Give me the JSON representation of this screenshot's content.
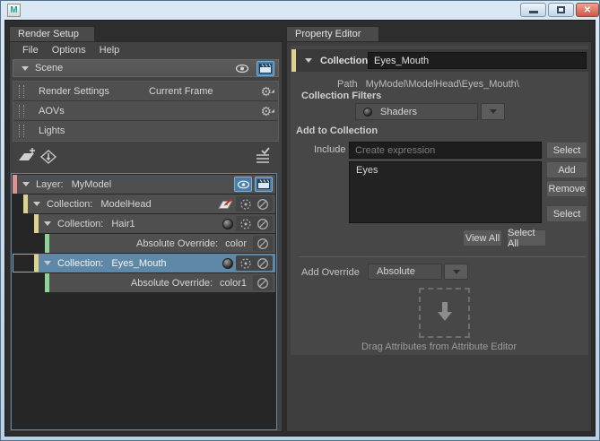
{
  "window": {
    "app_icon": "M",
    "controls": {
      "minimize": "minimize",
      "maximize": "maximize",
      "close": "close"
    }
  },
  "icons": {
    "gear": "⚙",
    "close_glyph": "✕"
  },
  "colors": {
    "selection_blue": "#5d88a8",
    "selection_border": "#7fb2d4",
    "icon_active_bg": "#4a7da8",
    "layer_bar": "#e2928e",
    "collection_bar": "#ddd38f",
    "override_bar": "#8fd497",
    "tree_focus_border": "#5f87a3"
  },
  "render_setup": {
    "tab_label": "Render Setup",
    "menu": {
      "file": "File",
      "options": "Options",
      "help": "Help"
    },
    "scene_row": {
      "label": "Scene"
    },
    "global_rows": [
      {
        "label": "Render Settings",
        "value": "Current Frame"
      },
      {
        "label": "AOVs",
        "value": ""
      },
      {
        "label": "Lights",
        "value": ""
      }
    ],
    "tree": [
      {
        "prefix": "Layer:",
        "name": "MyModel"
      },
      {
        "prefix": "Collection:",
        "name": "ModelHead"
      },
      {
        "prefix": "Collection:",
        "name": "Hair1"
      },
      {
        "prefix": "Absolute Override:",
        "name": "color"
      },
      {
        "prefix": "Collection:",
        "name": "Eyes_Mouth"
      },
      {
        "prefix": "Absolute Override:",
        "name": "color1"
      }
    ]
  },
  "property_editor": {
    "tab_label": "Property Editor",
    "header": {
      "label": "Collection:",
      "value": "Eyes_Mouth"
    },
    "path": {
      "label": "Path",
      "value": "MyModel\\ModelHead\\Eyes_Mouth\\"
    },
    "collection_filters": {
      "label": "Collection Filters",
      "selected": "Shaders"
    },
    "add_to_collection": {
      "label": "Add to Collection",
      "include_label": "Include",
      "include_placeholder": "Create expression",
      "select_button": "Select",
      "add_button": "Add",
      "remove_button": "Remove",
      "select_button2": "Select",
      "view_all_button": "View All",
      "select_all_button": "Select All",
      "list_items": [
        "Eyes"
      ]
    },
    "add_override": {
      "label": "Add Override",
      "selected": "Absolute",
      "drop_hint": "Drag Attributes from Attribute Editor"
    }
  }
}
